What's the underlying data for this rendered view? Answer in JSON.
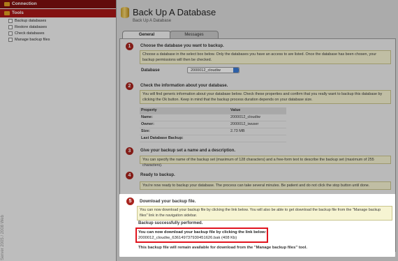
{
  "sidebar": {
    "connection_label": "Connection",
    "tools_label": "Tools",
    "items": [
      {
        "label": "Backup databases"
      },
      {
        "label": "Restore databases"
      },
      {
        "label": "Check databases"
      },
      {
        "label": "Manage backup files"
      }
    ],
    "vertical_text": "Server 2005 / 2008 Web"
  },
  "header": {
    "title": "Back Up A Database",
    "breadcrumb": "Back Up A Database"
  },
  "tabs": [
    {
      "label": "General",
      "active": true
    },
    {
      "label": "Messages",
      "active": false
    }
  ],
  "steps": [
    {
      "number": "1",
      "title": "Choose the database you want to backup.",
      "text": "Choose a database in the select box below. Only the databases you have an access to are listed. Once the database has been chosen, your backup permissions will then be checked."
    },
    {
      "number": "2",
      "title": "Check the information about your database.",
      "text": "You will find generic information about your database below. Check these properties and confirm that you really want to backup this database by clicking the Ok button. Keep in mind that the backup process duration depends on your database size."
    },
    {
      "number": "3",
      "title": "Give your backup set a name and a description.",
      "text": "You can specify the name of the backup set (maximum of 128 characters) and a free-form text to describe the backup set (maximum of 255 characters)."
    },
    {
      "number": "4",
      "title": "Ready to backup.",
      "text": "You're now ready to backup your database. The process can take several minutes. Be patient and do not click the stop button until done."
    },
    {
      "number": "5",
      "title": "Download your backup file.",
      "text": "You can now download your backup file by clicking the link below. You will also be able to get download the backup file from the \"Manage backup files\" link in the navigation sidebar."
    }
  ],
  "database_field": {
    "label": "Database",
    "value": "2000012_cloudiw"
  },
  "properties": {
    "headers": [
      "Property",
      "Value"
    ],
    "rows": [
      {
        "property": "Name:",
        "value": "2000012_cloudiw"
      },
      {
        "property": "Owner:",
        "value": "2000012_iwuser"
      },
      {
        "property": "Size:",
        "value": "2.73 MB"
      },
      {
        "property": "Last Database Backup:",
        "value": ""
      }
    ]
  },
  "result": {
    "success": "Backup successfully performed.",
    "download_label": "You can now download your backup file by clicking the link below:",
    "download_link": "2000012_cloudiw_63614973793045162​6.bak (408 Kb)",
    "availability": "This backup file will remain available for download from the \"Manage backup files\" tool."
  },
  "colors": {
    "accent_red": "#a8241e",
    "highlight_border": "#e0141e",
    "info_box": "#f6f4d2"
  }
}
